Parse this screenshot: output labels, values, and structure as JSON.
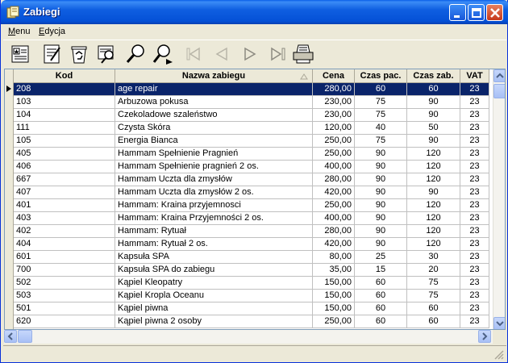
{
  "window": {
    "title": "Zabiegi"
  },
  "menu": [
    {
      "label": "Menu",
      "underline": "M"
    },
    {
      "label": "Edycja",
      "underline": "E"
    }
  ],
  "toolbar": {
    "icons": [
      "card-icon",
      "edit-note-icon",
      "recycle-bin-icon",
      "search-list-icon",
      "magnifier-icon",
      "find-next-icon",
      "first-record-icon",
      "prev-record-icon",
      "next-record-icon",
      "last-record-icon",
      "printer-icon"
    ]
  },
  "columns": {
    "kod": "Kod",
    "name": "Nazwa zabiegu",
    "cena": "Cena",
    "pac": "Czas pac.",
    "zab": "Czas zab.",
    "vat": "VAT"
  },
  "rows": [
    {
      "kod": "208",
      "name": "age repair",
      "cena": "280,00",
      "pac": "60",
      "zab": "60",
      "vat": "23",
      "selected": true
    },
    {
      "kod": "103",
      "name": "Arbuzowa pokusa",
      "cena": "230,00",
      "pac": "75",
      "zab": "90",
      "vat": "23"
    },
    {
      "kod": "104",
      "name": "Czekoladowe szaleństwo",
      "cena": "230,00",
      "pac": "75",
      "zab": "90",
      "vat": "23"
    },
    {
      "kod": "111",
      "name": "Czysta Skóra",
      "cena": "120,00",
      "pac": "40",
      "zab": "50",
      "vat": "23"
    },
    {
      "kod": "105",
      "name": "Energia Bianca",
      "cena": "250,00",
      "pac": "75",
      "zab": "90",
      "vat": "23"
    },
    {
      "kod": "405",
      "name": "Hammam Spełnienie Pragnień",
      "cena": "250,00",
      "pac": "90",
      "zab": "120",
      "vat": "23"
    },
    {
      "kod": "406",
      "name": "Hammam Spełnienie pragnień 2 os.",
      "cena": "400,00",
      "pac": "90",
      "zab": "120",
      "vat": "23"
    },
    {
      "kod": "667",
      "name": "Hammam Uczta dla zmysłów",
      "cena": "280,00",
      "pac": "90",
      "zab": "120",
      "vat": "23"
    },
    {
      "kod": "407",
      "name": "Hammam Uczta dla zmysłów 2 os.",
      "cena": "420,00",
      "pac": "90",
      "zab": "90",
      "vat": "23"
    },
    {
      "kod": "401",
      "name": "Hammam: Kraina przyjemnosci",
      "cena": "250,00",
      "pac": "90",
      "zab": "120",
      "vat": "23"
    },
    {
      "kod": "403",
      "name": "Hammam: Kraina Przyjemności 2 os.",
      "cena": "400,00",
      "pac": "90",
      "zab": "120",
      "vat": "23"
    },
    {
      "kod": "402",
      "name": "Hammam: Rytuał",
      "cena": "280,00",
      "pac": "90",
      "zab": "120",
      "vat": "23"
    },
    {
      "kod": "404",
      "name": "Hammam: Rytuał  2 os.",
      "cena": "420,00",
      "pac": "90",
      "zab": "120",
      "vat": "23"
    },
    {
      "kod": "601",
      "name": "Kapsuła SPA",
      "cena": "80,00",
      "pac": "25",
      "zab": "30",
      "vat": "23"
    },
    {
      "kod": "700",
      "name": "Kapsuła SPA do zabiegu",
      "cena": "35,00",
      "pac": "15",
      "zab": "20",
      "vat": "23"
    },
    {
      "kod": "502",
      "name": "Kąpiel Kleopatry",
      "cena": "150,00",
      "pac": "60",
      "zab": "75",
      "vat": "23"
    },
    {
      "kod": "503",
      "name": "Kąpiel Kropla Oceanu",
      "cena": "150,00",
      "pac": "60",
      "zab": "75",
      "vat": "23"
    },
    {
      "kod": "501",
      "name": "Kąpiel piwna",
      "cena": "150,00",
      "pac": "60",
      "zab": "60",
      "vat": "23"
    },
    {
      "kod": "620",
      "name": "Kąpiel piwna 2 osoby",
      "cena": "250,00",
      "pac": "60",
      "zab": "60",
      "vat": "23"
    }
  ]
}
